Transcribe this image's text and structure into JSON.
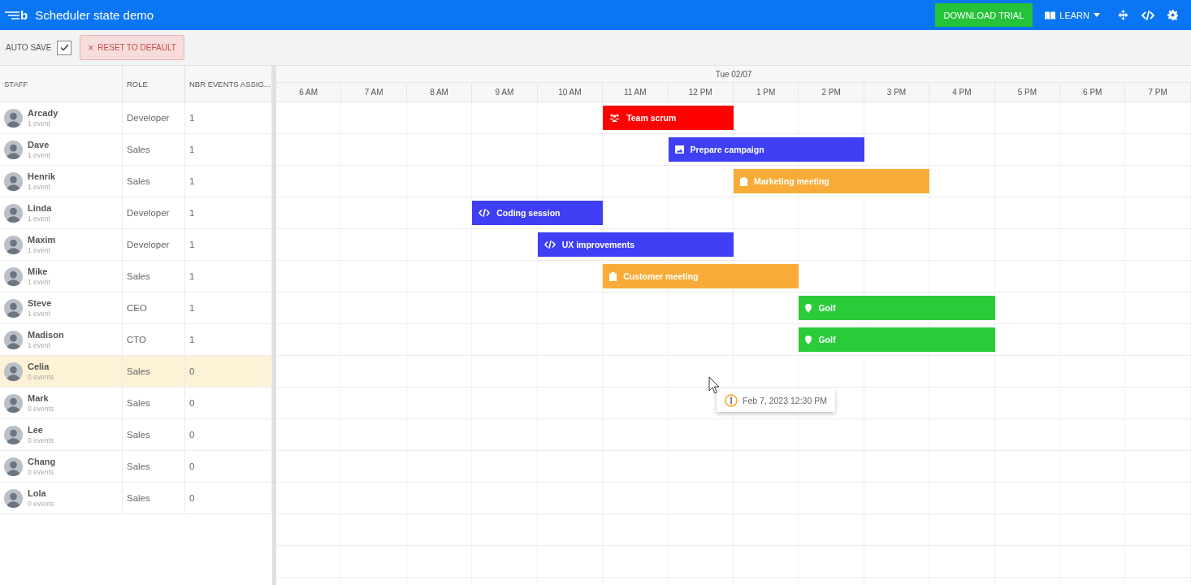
{
  "header": {
    "logo_letter": "b",
    "title": "Scheduler state demo",
    "download_button": "DOWNLOAD TRIAL",
    "learn_menu": "LEARN"
  },
  "toolbar": {
    "auto_save": {
      "label": "AUTO SAVE",
      "checked": true
    },
    "reset_button": {
      "icon": "×",
      "label": "RESET TO DEFAULT"
    }
  },
  "grid": {
    "columns": [
      "STAFF",
      "ROLE",
      "NBR EVENTS ASSIG..."
    ],
    "rows": [
      {
        "name": "Arcady",
        "events": "1 event",
        "role": "Developer",
        "count": "1",
        "selected": false,
        "bookings": [
          {
            "name": "Team scrum",
            "color": "#ff0000",
            "kind": "team"
          }
        ]
      },
      {
        "name": "Dave",
        "events": "1 event",
        "role": "Sales",
        "count": "1",
        "selected": false,
        "bookings": [
          {
            "name": "Prepare campaign",
            "color": "#3f3ff5",
            "kind": "image"
          }
        ]
      },
      {
        "name": "Henrik",
        "events": "1 event",
        "role": "Sales",
        "count": "1",
        "selected": false,
        "bookings": [
          {
            "name": "Marketing meeting",
            "color": "#f8ac37",
            "kind": "meeting"
          }
        ]
      },
      {
        "name": "Linda",
        "events": "1 event",
        "role": "Developer",
        "count": "1",
        "selected": false,
        "bookings": [
          {
            "name": "Coding session",
            "color": "#3f3ff5",
            "kind": "code"
          }
        ]
      },
      {
        "name": "Maxim",
        "events": "1 event",
        "role": "Developer",
        "count": "1",
        "selected": false,
        "bookings": [
          {
            "name": "UX improvements",
            "color": "#3f3ff5",
            "kind": "code"
          }
        ]
      },
      {
        "name": "Mike",
        "events": "1 event",
        "role": "Sales",
        "count": "1",
        "selected": false,
        "bookings": [
          {
            "name": "Customer meeting",
            "color": "#f8ac37",
            "kind": "meeting"
          }
        ]
      },
      {
        "name": "Steve",
        "events": "1 event",
        "role": "CEO",
        "count": "1",
        "selected": false,
        "bookings": [
          {
            "name": "Golf",
            "color": "#2bcc3a",
            "kind": "outdoor"
          }
        ]
      },
      {
        "name": "Madison",
        "events": "1 event",
        "role": "CTO",
        "count": "1",
        "selected": false,
        "bookings": [
          {
            "name": "Golf",
            "color": "#2bcc3a",
            "kind": "outdoor"
          }
        ]
      },
      {
        "name": "Celia",
        "events": "0 events",
        "role": "Sales",
        "count": "0",
        "selected": true
      },
      {
        "name": "Mark",
        "events": "0 events",
        "role": "Sales",
        "count": "0",
        "selected": false
      },
      {
        "name": "Lee",
        "events": "0 events",
        "role": "Sales",
        "count": "0",
        "selected": false
      },
      {
        "name": "Chang",
        "events": "0 events",
        "role": "Sales",
        "count": "0",
        "selected": false
      },
      {
        "name": "Lola",
        "events": "0 events",
        "role": "Sales",
        "count": "0",
        "selected": false
      }
    ]
  },
  "timeline": {
    "date": "Tue 02/07",
    "hours": [
      "6 AM",
      "7 AM",
      "8 AM",
      "9 AM",
      "10 AM",
      "11 AM",
      "12 PM",
      "1 PM",
      "2 PM",
      "3 PM",
      "4 PM",
      "5 PM",
      "6 PM",
      "7 PM"
    ],
    "tooltip": "Feb 7, 2023 12:30 PM"
  }
}
